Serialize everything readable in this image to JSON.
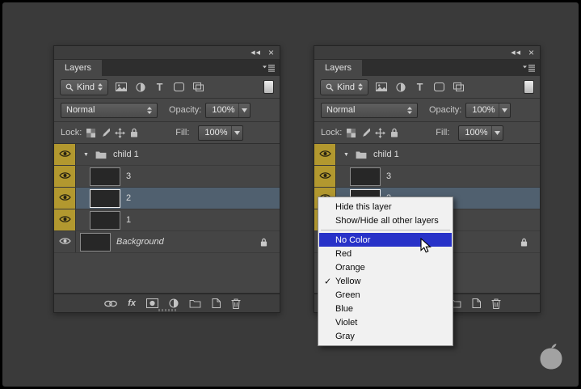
{
  "panel": {
    "tab": "Layers",
    "window_icons": {
      "collapse": "◀◀",
      "close": "×"
    },
    "filter": {
      "kind": "Kind"
    },
    "blend": {
      "mode": "Normal",
      "opacity_label": "Opacity:",
      "opacity_value": "100%"
    },
    "lock": {
      "label": "Lock:",
      "fill_label": "Fill:",
      "fill_value": "100%"
    },
    "layers": [
      {
        "name": "child 1",
        "kind": "group",
        "color_label": "yellow",
        "expanded": true,
        "visible": true
      },
      {
        "name": "3",
        "kind": "layer",
        "color_label": "yellow",
        "visible": true
      },
      {
        "name": "2",
        "kind": "layer",
        "color_label": "yellow",
        "visible": true,
        "selected": true
      },
      {
        "name": "1",
        "kind": "layer",
        "color_label": "yellow",
        "visible": true
      },
      {
        "name": "Background",
        "kind": "background",
        "visible": true,
        "locked": true
      }
    ],
    "footer_fx": "fx"
  },
  "context_menu": {
    "items": [
      {
        "label": "Hide this layer"
      },
      {
        "label": "Show/Hide all other layers"
      },
      {
        "type": "separator"
      },
      {
        "label": "No Color",
        "highlighted": true
      },
      {
        "label": "Red"
      },
      {
        "label": "Orange"
      },
      {
        "label": "Yellow",
        "checked": true
      },
      {
        "label": "Green"
      },
      {
        "label": "Blue"
      },
      {
        "label": "Violet"
      },
      {
        "label": "Gray"
      }
    ]
  },
  "glyphs": {
    "check": "✓",
    "expand": "▼",
    "type_icon": "T"
  },
  "colors": {
    "label_yellow": "#b2982f",
    "selection": "#50606f",
    "menu_highlight": "#2832c8"
  }
}
